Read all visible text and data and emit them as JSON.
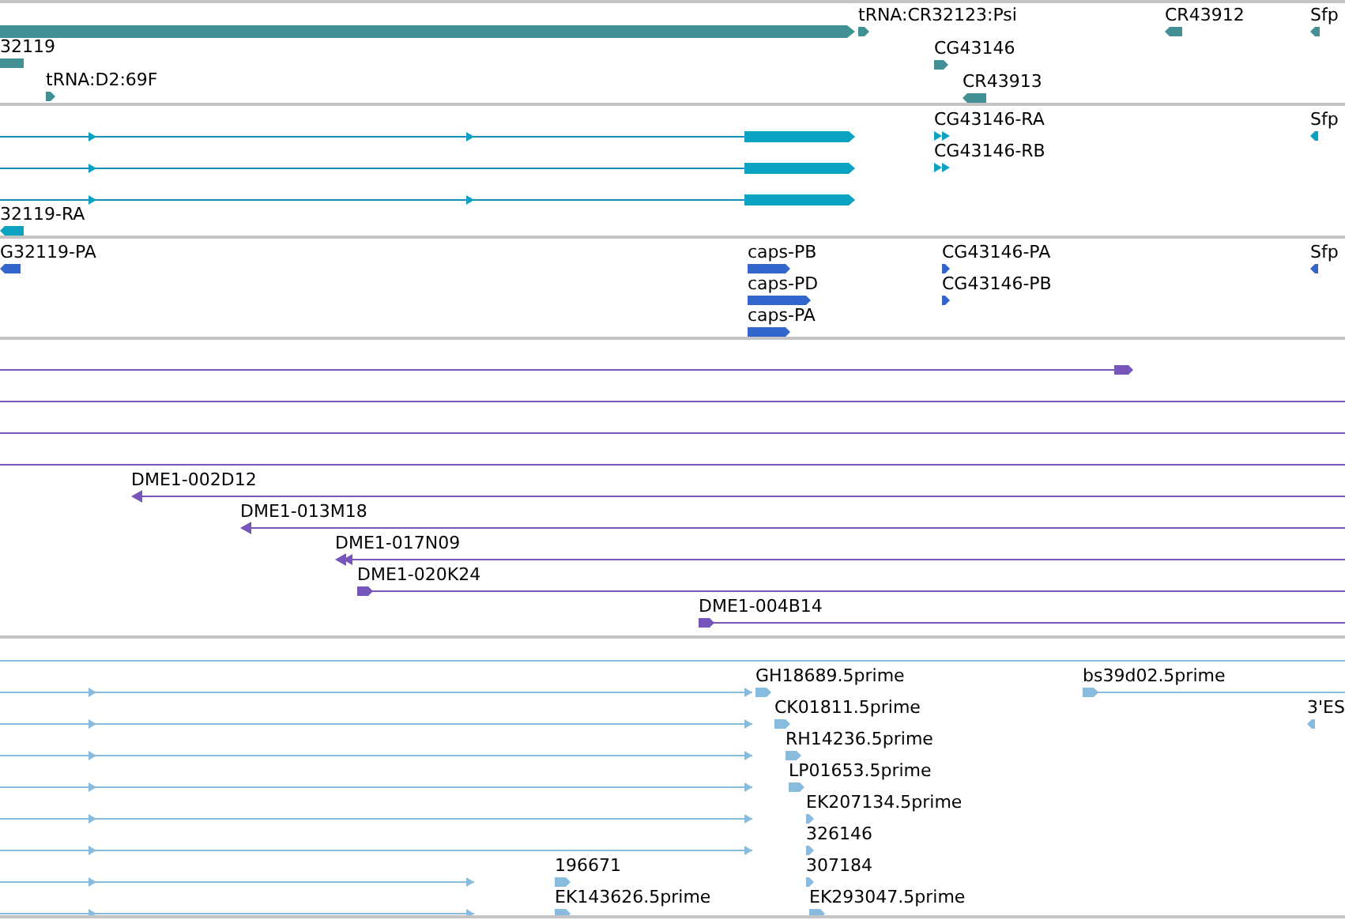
{
  "tracks": [
    {
      "features": [
        {
          "label": "tRNA:CR32123:Psi",
          "reverse": false
        },
        {
          "label": "CR43912",
          "reverse": true
        },
        {
          "label": "Sfp",
          "reverse": true
        },
        {
          "label": "32119"
        },
        {
          "label": "CG43146",
          "reverse": false
        },
        {
          "label": "tRNA:D2:69F",
          "reverse": false
        },
        {
          "label": "CR43913",
          "reverse": true
        }
      ]
    },
    {
      "features": [
        {
          "label": "CG43146-RA",
          "reverse": false
        },
        {
          "label": "Sfp",
          "reverse": true
        },
        {
          "label": "CG43146-RB",
          "reverse": false
        },
        {
          "label": "32119-RA",
          "reverse": true
        }
      ]
    },
    {
      "features": [
        {
          "label": "G32119-PA",
          "reverse": true
        },
        {
          "label": "caps-PB",
          "reverse": false
        },
        {
          "label": "CG43146-PA",
          "reverse": false
        },
        {
          "label": "Sfp",
          "reverse": true
        },
        {
          "label": "caps-PD",
          "reverse": false
        },
        {
          "label": "CG43146-PB",
          "reverse": false
        },
        {
          "label": "caps-PA",
          "reverse": false
        }
      ]
    },
    {
      "features": [
        {
          "label": "DME1-002D12",
          "reverse": true
        },
        {
          "label": "DME1-013M18",
          "reverse": true
        },
        {
          "label": "DME1-017N09",
          "reverse": true
        },
        {
          "label": "DME1-020K24",
          "reverse": false
        },
        {
          "label": "DME1-004B14",
          "reverse": false
        }
      ]
    },
    {
      "features": [
        {
          "label": "GH18689.5prime",
          "reverse": false
        },
        {
          "label": "bs39d02.5prime",
          "reverse": false
        },
        {
          "label": "CK01811.5prime",
          "reverse": false
        },
        {
          "label": "3'ES",
          "reverse": true
        },
        {
          "label": "RH14236.5prime",
          "reverse": false
        },
        {
          "label": "LP01653.5prime",
          "reverse": false
        },
        {
          "label": "EK207134.5prime",
          "reverse": false
        },
        {
          "label": "326146",
          "reverse": false
        },
        {
          "label": "196671",
          "reverse": false
        },
        {
          "label": "307184",
          "reverse": false
        },
        {
          "label": "EK143626.5prime",
          "reverse": false
        },
        {
          "label": "EK293047.5prime",
          "reverse": false
        }
      ]
    }
  ]
}
